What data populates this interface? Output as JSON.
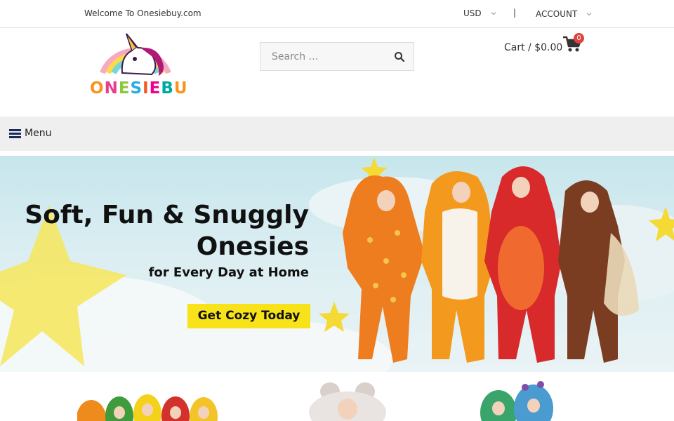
{
  "topbar": {
    "welcome": "Welcome To Onesiebuy.com",
    "currency": "USD",
    "separator": "|",
    "account": "ACCOUNT"
  },
  "header": {
    "logo_text": "ONESIEBUY",
    "search_placeholder": "Search …",
    "cart_label": "Cart / $0.00",
    "cart_count": "0"
  },
  "menu": {
    "label": "Menu"
  },
  "hero": {
    "headline_line1": "Soft, Fun & Snuggly",
    "headline_line2": "Onesies",
    "subheadline": "for Every Day at Home",
    "cta_label": "Get Cozy Today"
  },
  "colors": {
    "accent_yellow": "#f8e21a",
    "badge_red": "#e0433f",
    "menu_bar": "#efefef",
    "burger_navy": "#1c2a5a"
  }
}
